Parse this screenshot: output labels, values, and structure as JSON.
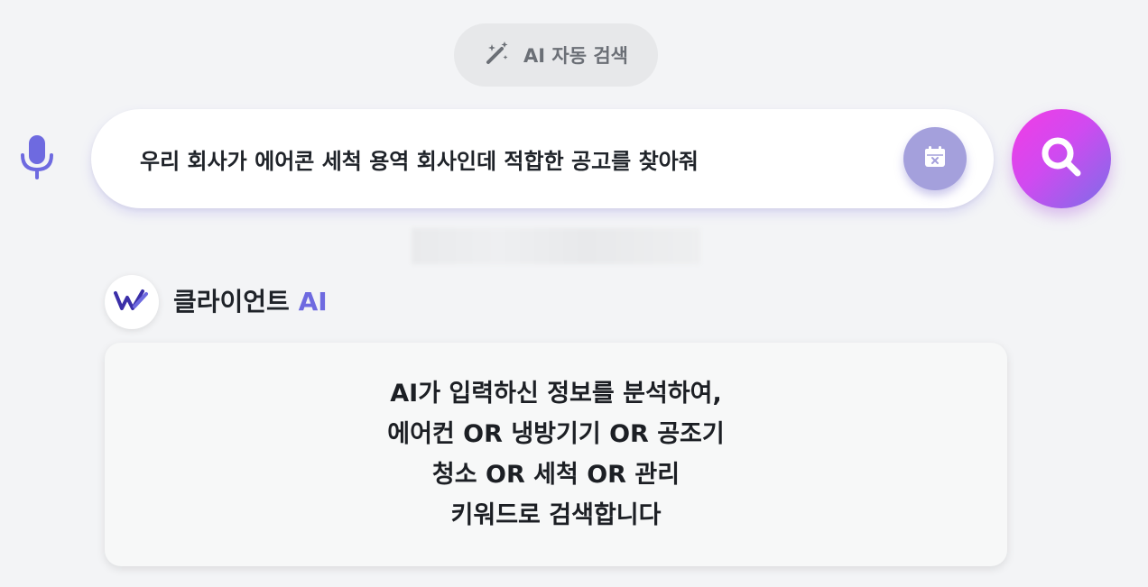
{
  "ai_toggle": {
    "label": "AI 자동 검색",
    "icon": "magic-wand-icon"
  },
  "search": {
    "mic_icon": "microphone-icon",
    "query": "우리 회사가 에어콘 세척 용역 회사인데 적합한 공고를 찾아줘",
    "calendar_icon": "calendar-clear-icon",
    "submit_icon": "search-icon"
  },
  "assistant": {
    "avatar_icon": "w-logo-icon",
    "name_prefix": "클라이언트",
    "name_accent": "AI",
    "message_lines": [
      "AI가 입력하신 정보를 분석하여,",
      "에어컨 OR 냉방기기 OR 공조기",
      "청소 OR 세척 OR 관리",
      "키워드로 검색합니다"
    ]
  },
  "colors": {
    "accent": "#6e6ae0",
    "search_gradient_start": "#f33ce5",
    "search_gradient_end": "#7b6ee8",
    "calendar_button": "#a4a0dc"
  }
}
